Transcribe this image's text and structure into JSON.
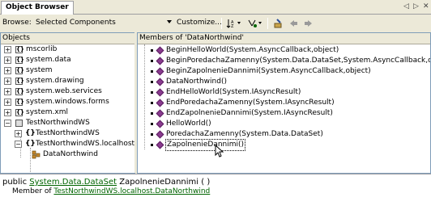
{
  "tab": {
    "title": "Object Browser",
    "nav_left": "◁",
    "nav_right": "▷",
    "close": "✕"
  },
  "toolbar": {
    "browse_label": "Browse:",
    "browse_value": "Selected Components",
    "customize_label": "Customize..."
  },
  "objects_pane": {
    "header": "Objects",
    "nodes": [
      {
        "label": "mscorlib",
        "level": 0,
        "expander": "+"
      },
      {
        "label": "system.data",
        "level": 0,
        "expander": "+"
      },
      {
        "label": "system",
        "level": 0,
        "expander": "+"
      },
      {
        "label": "system.drawing",
        "level": 0,
        "expander": "+"
      },
      {
        "label": "system.web.services",
        "level": 0,
        "expander": "+"
      },
      {
        "label": "system.windows.forms",
        "level": 0,
        "expander": "+"
      },
      {
        "label": "system.xml",
        "level": 0,
        "expander": "+"
      },
      {
        "label": "TestNorthwindWS",
        "level": 0,
        "expander": "−"
      },
      {
        "label": "TestNorthwindWS",
        "level": 1,
        "expander": "+"
      },
      {
        "label": "TestNorthwindWS.localhost",
        "level": 1,
        "expander": "−"
      },
      {
        "label": "DataNorthwind",
        "level": 2,
        "expander": ""
      }
    ]
  },
  "members_pane": {
    "header": "Members of 'DataNorthwind'",
    "items": [
      {
        "label": "BeginHelloWorld(System.AsyncCallback,object)"
      },
      {
        "label": "BeginPoredachaZamenny(System.Data.DataSet,System.AsyncCallback,object)"
      },
      {
        "label": "BeginZapolnenieDannimi(System.AsyncCallback,object)"
      },
      {
        "label": "DataNorthwind()"
      },
      {
        "label": "EndHelloWorld(System.IAsyncResult)"
      },
      {
        "label": "EndPoredachaZamenny(System.IAsyncResult)"
      },
      {
        "label": "EndZapolnenieDannimi(System.IAsyncResult)"
      },
      {
        "label": "HelloWorld()"
      },
      {
        "label": "PoredachaZamenny(System.Data.DataSet)"
      },
      {
        "label": "ZapolnenieDannimi()",
        "selected": true
      }
    ]
  },
  "description": {
    "prefix": "public ",
    "type_link": "System.Data.DataSet",
    "method": " ZapolnenieDannimi ( )",
    "member_of_label": "Member of ",
    "member_of_link": "TestNorthwindWS.localhost.DataNorthwind"
  },
  "colors": {
    "accent": "#006400",
    "method_icon": "#8a3b8f"
  }
}
